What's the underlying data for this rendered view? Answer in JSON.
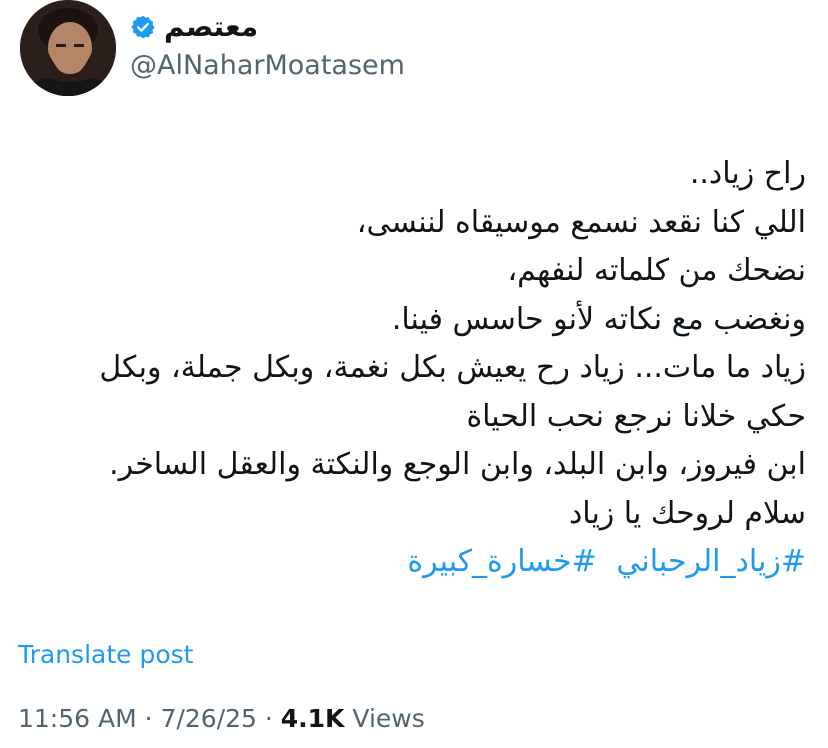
{
  "author": {
    "display_name": "معتصم",
    "handle": "@AlNaharMoatasem",
    "verified_icon": "verified-badge-icon",
    "verified_color": "#1d9bf0"
  },
  "tweet": {
    "lines": [
      "راح زياد..",
      "اللي كنا نقعد نسمع موسيقاه لننسى،",
      "نضحك من كلماته لنفهم،",
      "ونغضب مع نكاته لأنو حاسس فينا.",
      "زياد ما مات... زياد رح يعيش بكل نغمة، وبكل جملة، وبكل",
      "حكي خلانا نرجع نحب الحياة",
      "ابن فيروز، وابن البلد، وابن الوجع والنكتة والعقل الساخر.",
      "سلام لروحك يا زياد"
    ],
    "hashtags": [
      "#زياد_الرحباني",
      "#خسارة_كبيرة"
    ],
    "hashtag_color": "#1d9bf0"
  },
  "translate_label": "Translate post",
  "meta": {
    "time": "11:56 AM",
    "separator": "·",
    "date": "7/26/25",
    "views_count": "4.1K",
    "views_label": "Views"
  }
}
